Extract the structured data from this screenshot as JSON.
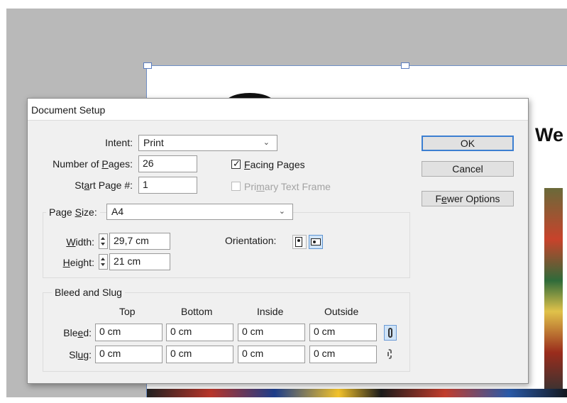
{
  "dialog": {
    "title": "Document Setup",
    "intent": {
      "label": "Intent:",
      "value": "Print"
    },
    "pages": {
      "label_pre": "Number of ",
      "label_ul": "P",
      "label_post": "ages:",
      "value": "26"
    },
    "start": {
      "label_pre": "St",
      "label_ul": "a",
      "label_post": "rt Page #:",
      "value": "1"
    },
    "facing": {
      "label_ul": "F",
      "label_post": "acing Pages",
      "checked": true
    },
    "primary": {
      "label_pre": "Pri",
      "label_ul": "m",
      "label_post": "ary Text Frame",
      "checked": false,
      "enabled": false
    },
    "page_size": {
      "label_pre": "Page ",
      "label_ul": "S",
      "label_post": "ize:",
      "value": "A4"
    },
    "width": {
      "label_ul": "W",
      "label_post": "idth:",
      "value": "29,7 cm"
    },
    "height": {
      "label_ul": "H",
      "label_post": "eight:",
      "value": "21 cm"
    },
    "orientation": {
      "label": "Orientation:",
      "selected": "landscape",
      "portrait_icon": "portrait-page-icon",
      "landscape_icon": "landscape-page-icon"
    },
    "bleed_slug": {
      "title": "Bleed and Slug",
      "columns": [
        "Top",
        "Bottom",
        "Inside",
        "Outside"
      ],
      "bleed": {
        "label_pre": "Ble",
        "label_ul": "e",
        "label_post": "d:",
        "values": [
          "0 cm",
          "0 cm",
          "0 cm",
          "0 cm"
        ],
        "linked": true
      },
      "slug": {
        "label_pre": "Sl",
        "label_ul": "u",
        "label_post": "g:",
        "values": [
          "0 cm",
          "0 cm",
          "0 cm",
          "0 cm"
        ],
        "linked": false
      }
    },
    "buttons": {
      "ok": "OK",
      "cancel": "Cancel",
      "fewer_pre": "F",
      "fewer_ul": "e",
      "fewer_post": "wer Options"
    }
  },
  "background": {
    "partial_heading": "We"
  },
  "colors": {
    "accent": "#3c7fd1",
    "selection": "#cfe3f7",
    "dialog_bg": "#f0f0f0",
    "canvas": "#b9b9b9"
  }
}
